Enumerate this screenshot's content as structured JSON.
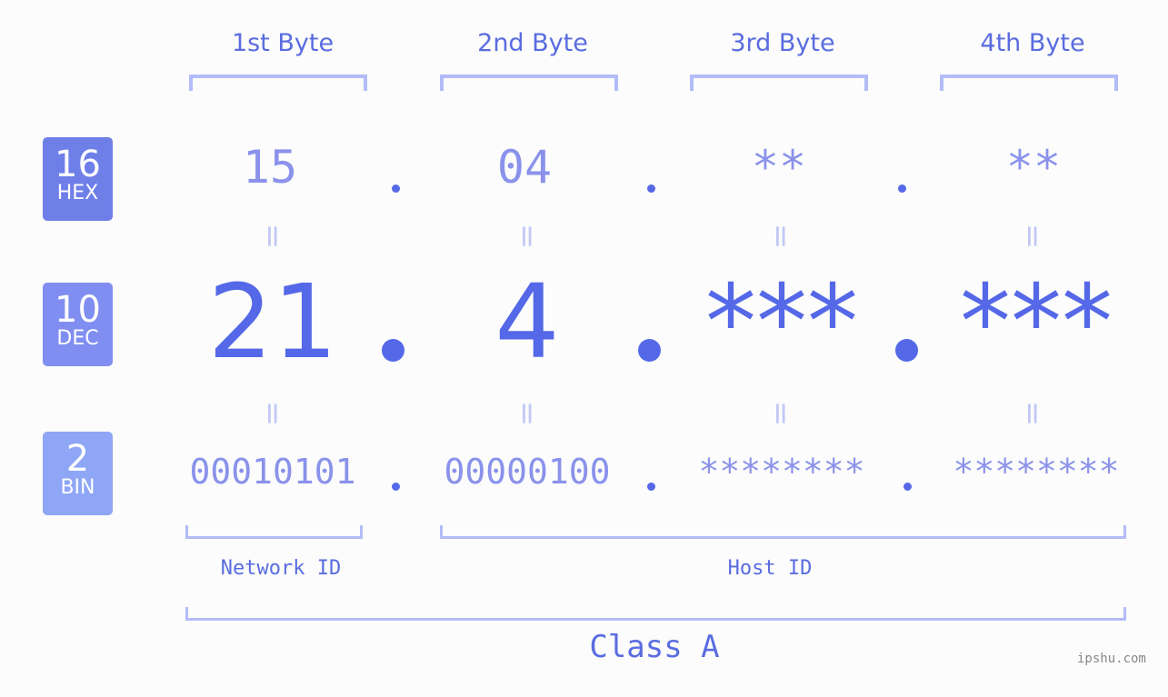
{
  "bytes": [
    {
      "label": "1st Byte",
      "hex": "15",
      "dec": "21",
      "bin": "00010101"
    },
    {
      "label": "2nd Byte",
      "hex": "04",
      "dec": "4",
      "bin": "00000100"
    },
    {
      "label": "3rd Byte",
      "hex": "**",
      "dec": "***",
      "bin": "********"
    },
    {
      "label": "4th Byte",
      "hex": "**",
      "dec": "***",
      "bin": "********"
    }
  ],
  "badges": [
    {
      "number": "16",
      "label": "HEX",
      "color": "#6f7fe8"
    },
    {
      "number": "10",
      "label": "DEC",
      "color": "#7f8ef0"
    },
    {
      "number": "2",
      "label": "BIN",
      "color": "#8ea6f5"
    }
  ],
  "equals_sign": "=",
  "network_label": "Network ID",
  "host_label": "Host ID",
  "class_label": "Class A",
  "watermark": "ipshu.com"
}
